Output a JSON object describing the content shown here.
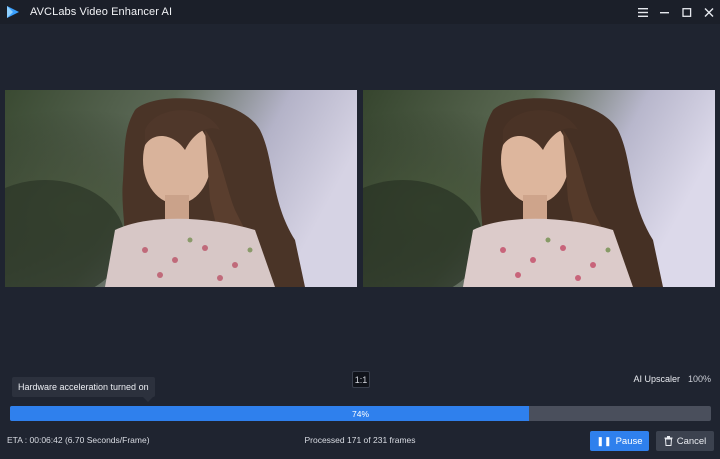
{
  "window": {
    "title": "AVCLabs Video Enhancer AI"
  },
  "preview": {
    "ratio_label": "1:1",
    "model_name": "AI Upscaler",
    "model_scale": "100%"
  },
  "status": {
    "tooltip": "Hardware acceleration turned on",
    "progress_fraction": 0.74,
    "progress_label": "74%",
    "eta": "ETA : 00:06:42 (6.70 Seconds/Frame)",
    "frames": "Processed 171 of 231 frames"
  },
  "actions": {
    "pause_label": "Pause",
    "pause_icon": "pause-icon",
    "cancel_label": "Cancel",
    "cancel_icon": "trash-icon"
  },
  "colors": {
    "accent": "#2f80ed",
    "background": "#1f2430",
    "track": "#4a4f5c"
  }
}
